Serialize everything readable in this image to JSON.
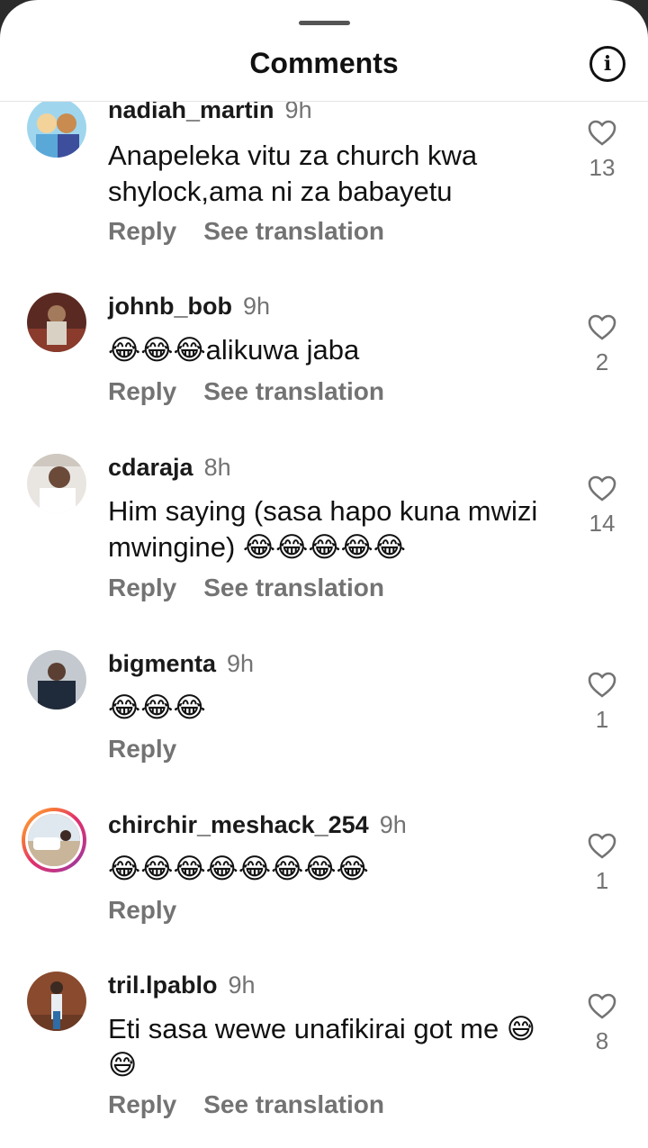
{
  "header": {
    "title": "Comments",
    "info_icon": "info-icon"
  },
  "colors": {
    "muted": "#737373",
    "text": "#111111",
    "story_ring": "#e1306c"
  },
  "comments": [
    {
      "username": "nadiah_martin",
      "time": "9h",
      "text": "Anapeleka vitu za church kwa shylock,ama ni za babayetu",
      "reply": "Reply",
      "translate": "See translation",
      "likes": "13"
    },
    {
      "username": "johnb_bob",
      "time": "9h",
      "text": "😂😂😂alikuwa jaba",
      "reply": "Reply",
      "translate": "See translation",
      "likes": "2"
    },
    {
      "username": "cdaraja",
      "time": "8h",
      "text": "Him saying (sasa hapo kuna mwizi mwingine) 😂😂😂😂😂",
      "reply": "Reply",
      "translate": "See translation",
      "likes": "14"
    },
    {
      "username": "bigmenta",
      "time": "9h",
      "text": "😂😂😂",
      "reply": "Reply",
      "likes": "1"
    },
    {
      "username": "chirchir_meshack_254",
      "time": "9h",
      "text": "😂😂😂😂😂😂😂😂",
      "reply": "Reply",
      "likes": "1"
    },
    {
      "username": "tril.lpablo",
      "time": "9h",
      "text": "Eti sasa wewe unafikirai got me 😅😅",
      "reply": "Reply",
      "translate": "See translation",
      "likes": "8"
    }
  ]
}
